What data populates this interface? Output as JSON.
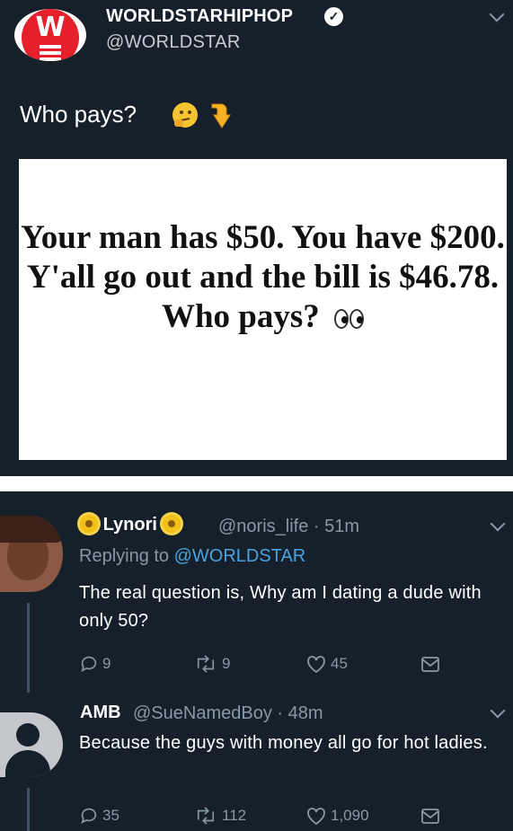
{
  "tweet": {
    "author_name": "WORLDSTARHIPHOP",
    "author_handle": "@WORLDSTAR",
    "logo_letter": "W",
    "text": "Who pays?",
    "emojis": [
      "thinking-face",
      "backhand-index-pointing-down"
    ],
    "media_text": "Your man has $50. You have $200. Y'all go out and the bill is $46.78. Who pays?",
    "media_emoji": "eyes"
  },
  "replies": [
    {
      "name": "Lynori",
      "handle": "@noris_life",
      "time": "· 51m",
      "replying_label": "Replying to",
      "replying_handle": "@WORLDSTAR",
      "text": "The real question is, Why am I dating a dude with only 50?",
      "replies_count": "9",
      "retweets_count": "9",
      "likes_count": "45"
    },
    {
      "name": "AMB",
      "handle": "@SueNamedBoy",
      "time": "· 48m",
      "text": "Because the guys with money all go for hot ladies.",
      "replies_count": "35",
      "retweets_count": "112",
      "likes_count": "1,090"
    }
  ],
  "colors": {
    "background": "#15202b",
    "secondary_text": "#8899a6",
    "link": "#4aa3df",
    "brand_red": "#e5202b"
  }
}
